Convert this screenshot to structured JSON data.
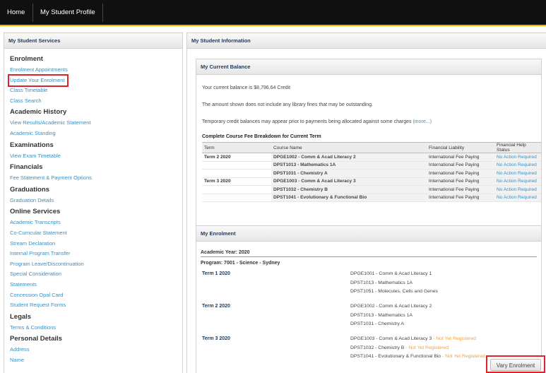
{
  "nav": {
    "home": "Home",
    "profile": "My Student Profile"
  },
  "sidebar": {
    "title": "My Student Services",
    "sections": [
      {
        "heading": "Enrolment",
        "links": [
          "Enrolment Appointments",
          "Update Your Enrolment",
          "Class Timetable",
          "Class Search"
        ]
      },
      {
        "heading": "Academic History",
        "links": [
          "View Results/Academic Statement",
          "Academic Standing"
        ]
      },
      {
        "heading": "Examinations",
        "links": [
          "View Exam Timetable"
        ]
      },
      {
        "heading": "Financials",
        "links": [
          "Fee Statement & Payment Options"
        ]
      },
      {
        "heading": "Graduations",
        "links": [
          "Graduation Details"
        ]
      },
      {
        "heading": "Online Services",
        "links": [
          "Academic Transcripts",
          "Co-Curricular Statement",
          "Stream Declaration",
          "Internal Program Transfer",
          "Program Leave/Discontinuation",
          "Special Consideration",
          "Statements",
          "Concession Opal Card",
          "Student Request Forms"
        ]
      },
      {
        "heading": "Legals",
        "links": [
          "Terms & Conditions"
        ]
      },
      {
        "heading": "Personal Details",
        "links": [
          "Address",
          "Name"
        ]
      }
    ]
  },
  "main": {
    "title": "My Student Information"
  },
  "balance": {
    "title": "My Current Balance",
    "line1": "Your current balance is $8,796.64 Credit",
    "line2": "The amount shown does not include any library fines that may be outstanding.",
    "line3": "Temporary credit balances may appear prior to payments being allocated against some charges",
    "more": "(more...)",
    "fee_title": "Complete Course Fee Breakdown for Current Term",
    "columns": [
      "Term",
      "Course Name",
      "Financial Liability",
      "Financial Help Status"
    ],
    "rows": [
      {
        "term": "Term 2 2020",
        "course": "DPGE1002 - Comm & Acad Literacy 2",
        "liability": "International Fee Paying",
        "help": "No Action Required"
      },
      {
        "term": "",
        "course": "DPST1013 - Mathematics 1A",
        "liability": "International Fee Paying",
        "help": "No Action Required"
      },
      {
        "term": "",
        "course": "DPST1031 - Chemistry A",
        "liability": "International Fee Paying",
        "help": "No Action Required"
      },
      {
        "term": "Term 3 2020",
        "course": "DPGE1003 - Comm & Acad Literacy 3",
        "liability": "International Fee Paying",
        "help": "No Action Required"
      },
      {
        "term": "",
        "course": "DPST1032 - Chemistry B",
        "liability": "International Fee Paying",
        "help": "No Action Required"
      },
      {
        "term": "",
        "course": "DPST1041 - Evolutionary & Functional Bio",
        "liability": "International Fee Paying",
        "help": "No Action Required"
      }
    ]
  },
  "enrolment": {
    "title": "My Enrolment",
    "academic_year": "Academic Year: 2020",
    "program": "Program: 7001 - Science - Sydney",
    "terms": [
      {
        "label": "Term 1 2020",
        "courses": [
          {
            "name": "DPGE1001 - Comm & Acad Literacy 1",
            "status": ""
          },
          {
            "name": "DPST1013 - Mathematics 1A",
            "status": ""
          },
          {
            "name": "DPST1051 - Molecules, Cells and Genes",
            "status": ""
          }
        ]
      },
      {
        "label": "Term 2 2020",
        "courses": [
          {
            "name": "DPGE1002 - Comm & Acad Literacy 2",
            "status": ""
          },
          {
            "name": "DPST1013 - Mathematics 1A",
            "status": ""
          },
          {
            "name": "DPST1031 - Chemistry A",
            "status": ""
          }
        ]
      },
      {
        "label": "Term 3 2020",
        "courses": [
          {
            "name": "DPGE1003 - Comm & Acad Literacy 3",
            "status": " - Not Yet Registered"
          },
          {
            "name": "DPST1032 - Chemistry B",
            "status": " - Not Yet Registered"
          },
          {
            "name": "DPST1041 - Evolutionary & Functional Bio",
            "status": " - Not Yet Registered"
          }
        ]
      }
    ],
    "vary_button": "Vary Enrolment"
  },
  "colors": {
    "link": "#3a8fc4",
    "highlight_box": "#e0202a",
    "not_registered": "#f0a040",
    "topbar": "#101010"
  }
}
